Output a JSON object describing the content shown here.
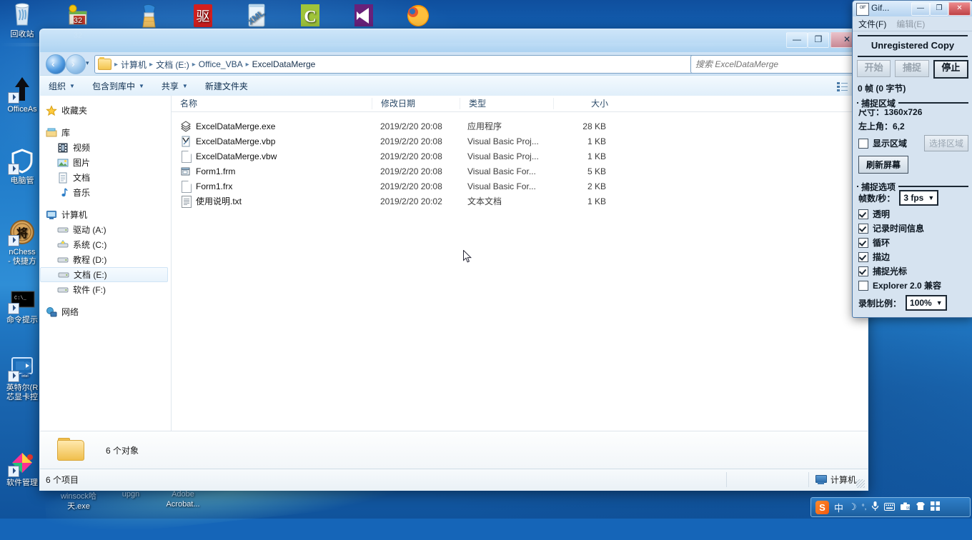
{
  "desktop": {
    "left_icons": [
      {
        "name": "回收站",
        "icon": "recycle-bin-icon"
      },
      {
        "name": "OfficeAs",
        "icon": "office-assistant-icon"
      },
      {
        "name": "电脑管",
        "icon": "computer-manager-icon"
      },
      {
        "name": "nChess\n- 快捷方",
        "icon": "chess-icon"
      },
      {
        "name": "命令提示",
        "icon": "command-prompt-icon"
      },
      {
        "name": "英特尔(R\n芯显卡控",
        "icon": "intel-graphics-icon"
      },
      {
        "name": "软件管理",
        "icon": "software-manager-icon"
      }
    ],
    "top_icons": [
      {
        "name": "32",
        "icon": "vb32-icon"
      },
      {
        "name": "",
        "icon": "cleaner-icon"
      },
      {
        "name": "",
        "icon": "driver-icon"
      },
      {
        "name": "",
        "icon": "xml-icon"
      },
      {
        "name": "",
        "icon": "c-language-icon"
      },
      {
        "name": "",
        "icon": "visual-studio-icon"
      },
      {
        "name": "",
        "icon": "firefox-icon"
      }
    ],
    "bottom_labels": [
      {
        "text": "winsock哈"
      },
      {
        "text": "天.exe"
      },
      {
        "text": "upgn"
      },
      {
        "text": "Adobe"
      },
      {
        "text": "Acrobat..."
      }
    ]
  },
  "explorer": {
    "window_buttons": {
      "minimize": "—",
      "maximize": "❐",
      "close": "✕"
    },
    "address": {
      "breadcrumbs": [
        "计算机",
        "文档 (E:)",
        "Office_VBA",
        "ExcelDataMerge"
      ],
      "separator": "▸",
      "dropdown": "▼",
      "refresh_icon": "refresh-icon"
    },
    "search": {
      "placeholder": "搜索 ExcelDataMerge",
      "value": ""
    },
    "toolbar": {
      "items": [
        {
          "label": "组织",
          "caret": "▼"
        },
        {
          "label": "包含到库中",
          "caret": "▼"
        },
        {
          "label": "共享",
          "caret": "▼"
        },
        {
          "label": "新建文件夹",
          "caret": ""
        }
      ],
      "view_caret": "▼"
    },
    "navpane": {
      "groups": [
        {
          "items": [
            {
              "label": "收藏夹",
              "icon": "star-icon",
              "level": 0,
              "selected": false
            }
          ]
        },
        {
          "items": [
            {
              "label": "库",
              "icon": "library-icon",
              "level": 0,
              "selected": false
            },
            {
              "label": "视频",
              "icon": "video-icon",
              "level": 1,
              "selected": false
            },
            {
              "label": "图片",
              "icon": "picture-icon",
              "level": 1,
              "selected": false
            },
            {
              "label": "文档",
              "icon": "document-icon",
              "level": 1,
              "selected": false
            },
            {
              "label": "音乐",
              "icon": "music-icon",
              "level": 1,
              "selected": false
            }
          ]
        },
        {
          "items": [
            {
              "label": "计算机",
              "icon": "computer-icon",
              "level": 0,
              "selected": false
            },
            {
              "label": "驱动 (A:)",
              "icon": "drive-icon",
              "level": 1,
              "selected": false
            },
            {
              "label": "系统 (C:)",
              "icon": "system-drive-icon",
              "level": 1,
              "selected": false
            },
            {
              "label": "教程 (D:)",
              "icon": "drive-icon",
              "level": 1,
              "selected": false
            },
            {
              "label": "文档 (E:)",
              "icon": "drive-icon",
              "level": 1,
              "selected": true
            },
            {
              "label": "软件 (F:)",
              "icon": "drive-icon",
              "level": 1,
              "selected": false
            }
          ]
        },
        {
          "items": [
            {
              "label": "网络",
              "icon": "network-icon",
              "level": 0,
              "selected": false
            }
          ]
        }
      ]
    },
    "columns": [
      "名称",
      "修改日期",
      "类型",
      "大小"
    ],
    "files": [
      {
        "name": "ExcelDataMerge.exe",
        "date": "2019/2/20 20:08",
        "type": "应用程序",
        "size": "28 KB",
        "icon": "exe-icon"
      },
      {
        "name": "ExcelDataMerge.vbp",
        "date": "2019/2/20 20:08",
        "type": "Visual Basic Proj...",
        "size": "1 KB",
        "icon": "vbp-icon"
      },
      {
        "name": "ExcelDataMerge.vbw",
        "date": "2019/2/20 20:08",
        "type": "Visual Basic Proj...",
        "size": "1 KB",
        "icon": "blank-doc-icon"
      },
      {
        "name": "Form1.frm",
        "date": "2019/2/20 20:08",
        "type": "Visual Basic For...",
        "size": "5 KB",
        "icon": "frm-icon"
      },
      {
        "name": "Form1.frx",
        "date": "2019/2/20 20:08",
        "type": "Visual Basic For...",
        "size": "2 KB",
        "icon": "blank-doc-icon"
      },
      {
        "name": "使用说明.txt",
        "date": "2019/2/20 20:02",
        "type": "文本文档",
        "size": "1 KB",
        "icon": "text-file-icon"
      }
    ],
    "details": {
      "text": "6 个对象",
      "folder_icon": "folder-icon"
    },
    "statusbar": {
      "left": "6 个项目",
      "computer": "计算机",
      "computer_icon": "computer-icon"
    }
  },
  "gif_recorder": {
    "title": "Gif...",
    "window_buttons": {
      "minimize": "—",
      "maximize": "❐",
      "close": "✕"
    },
    "menu": [
      {
        "label": "文件(F)",
        "enabled": true
      },
      {
        "label": "编辑(E)",
        "enabled": false
      }
    ],
    "banner": "Unregistered Copy",
    "buttons": [
      {
        "label": "开始",
        "state": "disabled"
      },
      {
        "label": "捕捉",
        "state": "disabled"
      },
      {
        "label": "停止",
        "state": "active"
      }
    ],
    "frames_text": "0 帧 (0 字节)",
    "capture_area": {
      "legend": "捕捉区域",
      "size_label": "尺寸：1360x726",
      "origin_label": "左上角：6,2",
      "show_area": {
        "label": "显示区域",
        "checked": false
      },
      "select_area_button": "选择区域",
      "refresh_button": "刷新屏幕"
    },
    "capture_options": {
      "legend": "捕捉选项",
      "fps_label": "帧数/秒：",
      "fps_value": "3 fps",
      "checkboxes": [
        {
          "label": "透明",
          "checked": true
        },
        {
          "label": "记录时间信息",
          "checked": true
        },
        {
          "label": "循环",
          "checked": true
        },
        {
          "label": "描边",
          "checked": true
        },
        {
          "label": "捕捉光标",
          "checked": true
        },
        {
          "label": "Explorer 2.0 兼容",
          "checked": false
        }
      ],
      "scale_label": "录制比例：",
      "scale_value": "100%"
    }
  },
  "tray": {
    "logo": "S",
    "items": [
      {
        "icon": "chinese-input-icon",
        "glyph": "中"
      },
      {
        "icon": "moon-icon",
        "glyph": "☽"
      },
      {
        "icon": "degree-icon",
        "glyph": "°,"
      },
      {
        "icon": "microphone-icon",
        "glyph": "🎤"
      },
      {
        "icon": "keyboard-icon",
        "glyph": "⌨"
      },
      {
        "icon": "toolbox-icon",
        "glyph": "🧰"
      },
      {
        "icon": "skin-icon",
        "glyph": "👕"
      },
      {
        "icon": "menu-grid-icon",
        "glyph": "▦"
      }
    ]
  }
}
